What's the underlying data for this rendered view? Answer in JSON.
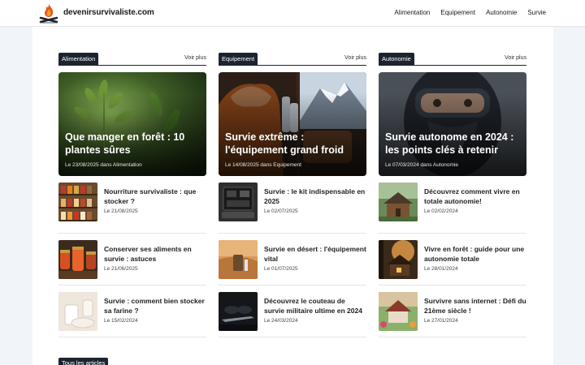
{
  "header": {
    "site_name": "devenirsurvivaliste.com",
    "nav": [
      "Alimentation",
      "Equipement",
      "Autonomie",
      "Survie"
    ]
  },
  "footer": {
    "all_articles": "Tous les articles"
  },
  "sections": [
    {
      "tag": "Alimentation",
      "more": "Voir plus",
      "featured": {
        "title": "Que manger en forêt : 10 plantes sûres",
        "meta": "Le 23/08/2025 dans Alimentation"
      },
      "items": [
        {
          "title": "Nourriture survivaliste : que stocker ?",
          "date": "Le 21/08/2025"
        },
        {
          "title": "Conserver ses aliments en survie : astuces",
          "date": "Le 21/06/2025"
        },
        {
          "title": "Survie : comment bien stocker sa farine ?",
          "date": "Le 15/02/2024"
        }
      ]
    },
    {
      "tag": "Equipement",
      "more": "Voir plus",
      "featured": {
        "title": "Survie extrême : l'équipement grand froid",
        "meta": "Le 14/08/2025 dans Equipement"
      },
      "items": [
        {
          "title": "Survie : le kit indispensable en 2025",
          "date": "Le 02/07/2025"
        },
        {
          "title": "Survie en désert : l'équipement vital",
          "date": "Le 01/07/2025"
        },
        {
          "title": "Découvrez le couteau de survie militaire ultime en 2024",
          "date": "Le 24/03/2024"
        }
      ]
    },
    {
      "tag": "Autonomie",
      "more": "Voir plus",
      "featured": {
        "title": "Survie autonome en 2024 : les points clés à retenir",
        "meta": "Le 07/03/2024 dans Autonomie"
      },
      "items": [
        {
          "title": "Découvrez comment vivre en totale autonomie!",
          "date": "Le 02/02/2024"
        },
        {
          "title": "Vivre en forêt : guide pour une autonomie totale",
          "date": "Le 28/01/2024"
        },
        {
          "title": "Survivre sans internet : Défi du 21ème siècle !",
          "date": "Le 27/01/2024"
        }
      ]
    }
  ]
}
